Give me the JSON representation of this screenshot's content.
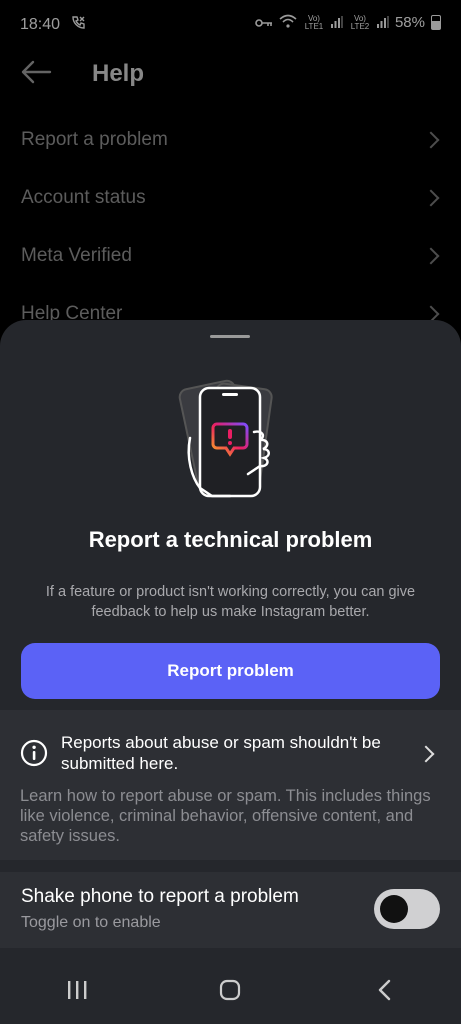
{
  "status_bar": {
    "time": "18:40",
    "left_icon": "call-forward-icon",
    "network1": "Vo) LTE1",
    "network2": "Vo) LTE2",
    "battery": "58%"
  },
  "header": {
    "title": "Help",
    "back_icon": "arrow-left-icon"
  },
  "menu": {
    "items": [
      {
        "label": "Report a problem"
      },
      {
        "label": "Account status"
      },
      {
        "label": "Meta Verified"
      },
      {
        "label": "Help Center"
      }
    ]
  },
  "sheet": {
    "title": "Report a technical problem",
    "description": "If a feature or product isn't working correctly, you can give feedback to help us make Instagram better.",
    "primary_button": "Report problem",
    "accent_color": "#5b62f6",
    "abuse": {
      "title": "Reports about abuse or spam shouldn't be submitted here.",
      "description": "Learn how to report abuse or spam. This includes things like violence, criminal behavior, offensive content, and safety issues."
    },
    "shake": {
      "title": "Shake phone to report a problem",
      "subtitle": "Toggle on to enable",
      "enabled": false
    }
  },
  "navbar": {
    "recents_icon": "recents-icon",
    "home_icon": "home-icon",
    "back_icon": "back-icon"
  }
}
